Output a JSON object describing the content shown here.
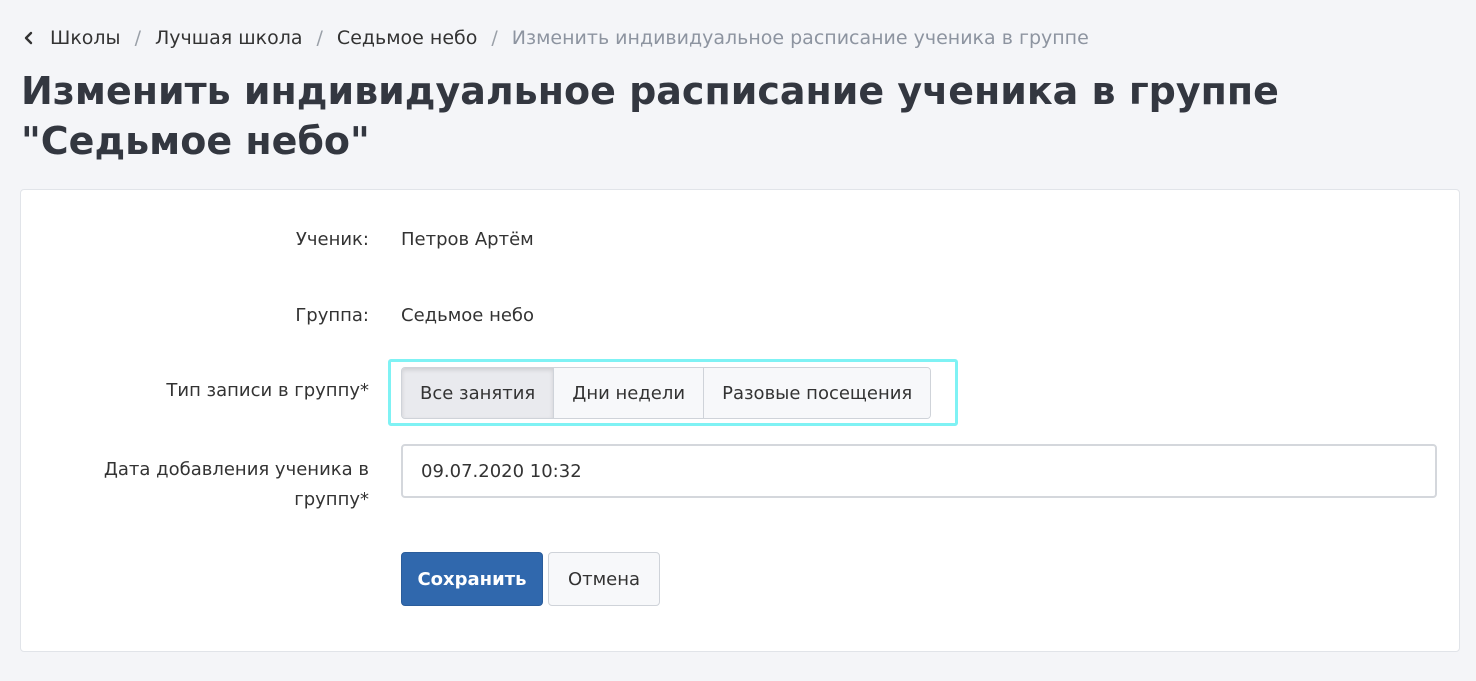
{
  "breadcrumb": {
    "back_icon": "chevron-left-icon",
    "items": [
      "Школы",
      "Лучшая школа",
      "Седьмое небо"
    ],
    "current": "Изменить индивидуальное расписание ученика в группе",
    "separator": "/"
  },
  "page": {
    "title": "Изменить индивидуальное расписание ученика в группе \"Седьмое небо\""
  },
  "form": {
    "student_label": "Ученик:",
    "student_value": "Петров Артём",
    "group_label": "Группа:",
    "group_value": "Седьмое небо",
    "type_label": "Тип записи в группу*",
    "type_options": [
      "Все занятия",
      "Дни недели",
      "Разовые посещения"
    ],
    "type_selected": "Все занятия",
    "date_label_line1": "Дата добавления ученика в",
    "date_label_line2": "группу*",
    "date_value": "09.07.2020 10:32",
    "save_label": "Сохранить",
    "cancel_label": "Отмена"
  },
  "colors": {
    "primary": "#3068ad",
    "highlight": "#7ff2f4",
    "background": "#f4f5f8"
  }
}
